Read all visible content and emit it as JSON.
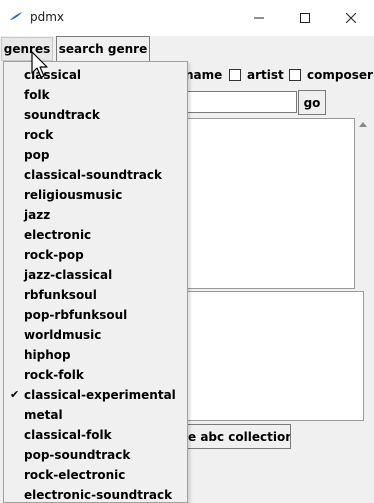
{
  "window": {
    "title": "pdmx"
  },
  "menubar": {
    "genres_label": "genres",
    "search_genre_label": "search genre"
  },
  "search": {
    "checkbox_name_label": "name",
    "checkbox_artist_label": "artist",
    "checkbox_composer_label": "composer",
    "go_label": "go"
  },
  "actions": {
    "save_label": "e abc collection"
  },
  "genres_menu": {
    "selected": "classical-experimental",
    "items": [
      "classical",
      "folk",
      "soundtrack",
      "rock",
      "pop",
      "classical-soundtrack",
      "religiousmusic",
      "jazz",
      "electronic",
      "rock-pop",
      "jazz-classical",
      "rbfunksoul",
      "pop-rbfunksoul",
      "worldmusic",
      "hiphop",
      "rock-folk",
      "classical-experimental",
      "metal",
      "classical-folk",
      "pop-soundtrack",
      "rock-electronic",
      "electronic-soundtrack"
    ]
  },
  "icons": {
    "app": "feather-icon",
    "minimize": "minimize-icon",
    "maximize": "maximize-icon",
    "close": "close-icon",
    "check": "checkmark-icon"
  }
}
